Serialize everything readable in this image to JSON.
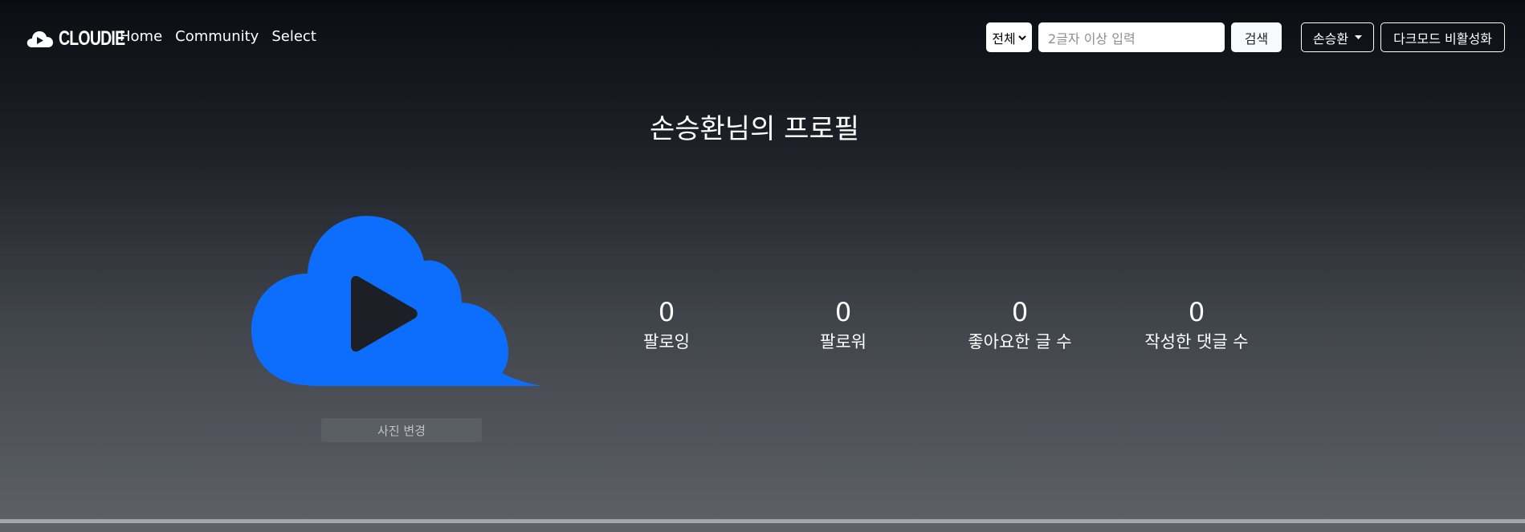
{
  "nav": {
    "brand": "CLOUDIE",
    "links": [
      "Home",
      "Community",
      "Select"
    ]
  },
  "search": {
    "category": "전체",
    "placeholder": "2글자 이상 입력",
    "button": "검색"
  },
  "user": {
    "name": "손승환",
    "darkmode_toggle": "다크모드 비활성화"
  },
  "profile": {
    "title": "손승환님의 프로필",
    "change_photo": "사진 변경",
    "stats": [
      {
        "value": "0",
        "label": "팔로잉"
      },
      {
        "value": "0",
        "label": "팔로워"
      },
      {
        "value": "0",
        "label": "좋아요한 글 수"
      },
      {
        "value": "0",
        "label": "작성한 댓글 수"
      }
    ]
  },
  "colors": {
    "accent": "#0d6efd",
    "avatar_cloud": "#0d6efd"
  }
}
